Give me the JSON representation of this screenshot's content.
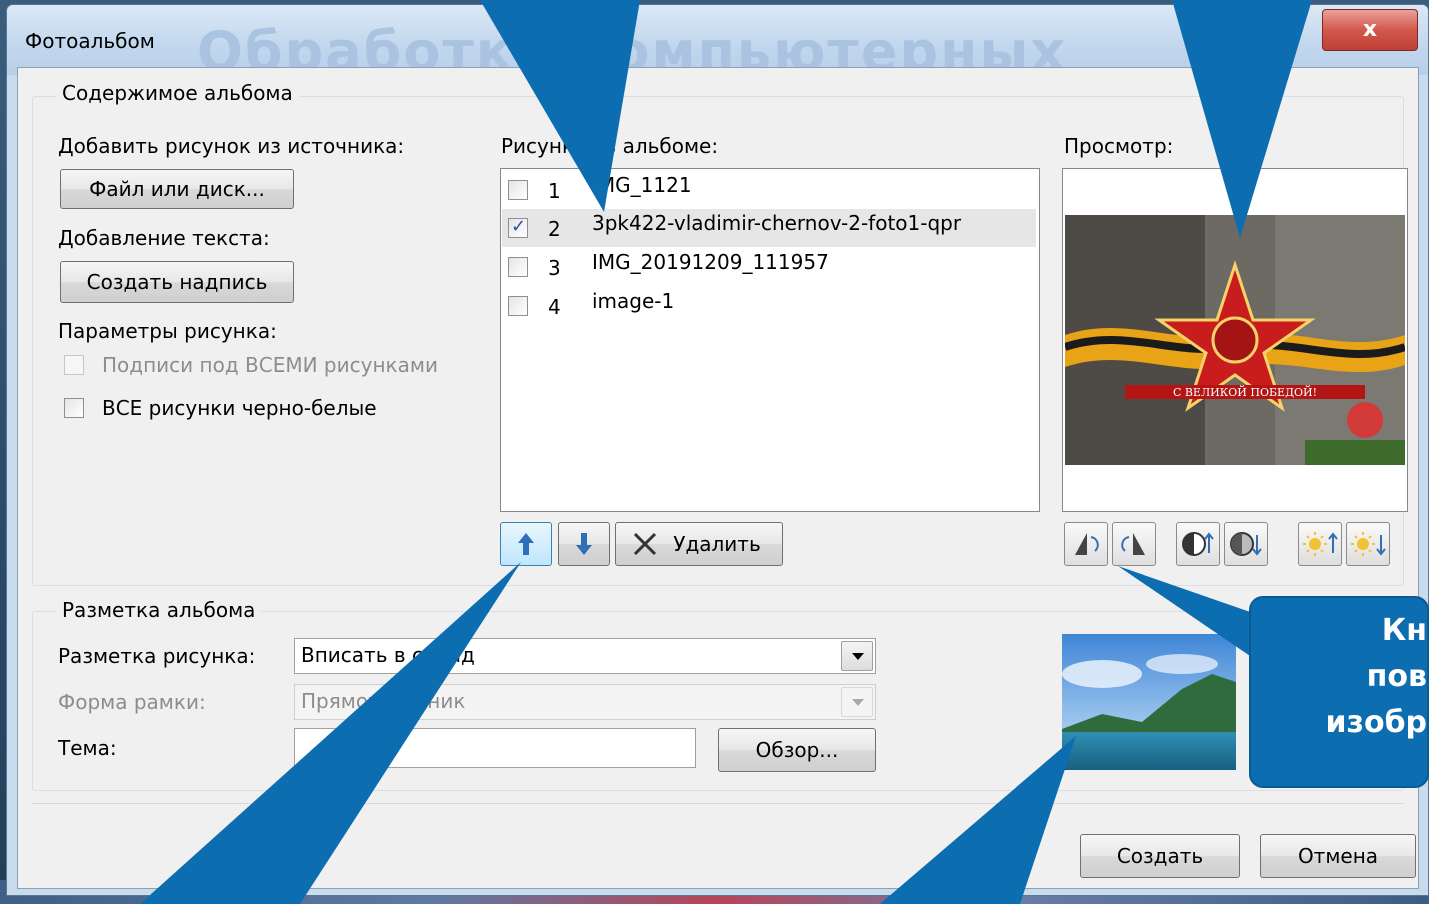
{
  "window": {
    "title": "Фотоальбом",
    "watermark": "Обработка компьютерных",
    "close_glyph": "x"
  },
  "content_group": {
    "caption": "Содержимое альбома",
    "add_from_source_label": "Добавить рисунок из источника:",
    "file_or_disk_button": "Файл или диск...",
    "add_text_label": "Добавление текста:",
    "create_caption_button": "Создать надпись",
    "picture_options_label": "Параметры рисунка:",
    "captions_below_all": {
      "label": "Подписи под ВСЕМИ рисунками",
      "checked": false,
      "enabled": false
    },
    "all_black_white": {
      "label": "ВСЕ рисунки черно-белые",
      "checked": false,
      "enabled": true
    },
    "pictures_in_album_label": "Рисунков в альбоме:",
    "pictures": [
      {
        "num": "1",
        "name": "IMG_1121",
        "checked": false,
        "selected": false
      },
      {
        "num": "2",
        "name": "3pk422-vladimir-chernov-2-foto1-qpr",
        "checked": true,
        "selected": true
      },
      {
        "num": "3",
        "name": "IMG_20191209_111957",
        "checked": false,
        "selected": false
      },
      {
        "num": "4",
        "name": "image-1",
        "checked": false,
        "selected": false
      }
    ],
    "move_up_icon": "arrow-up-icon",
    "move_down_icon": "arrow-down-icon",
    "remove_button": "Удалить",
    "preview_label": "Просмотр:",
    "preview_banner_text": "С ВЕЛИКОЙ ПОБЕДОЙ!",
    "image_tools": [
      "rotate-left-icon",
      "rotate-right-icon",
      "contrast-up-icon",
      "contrast-down-icon",
      "brightness-up-icon",
      "brightness-down-icon"
    ]
  },
  "layout_group": {
    "caption": "Разметка альбома",
    "picture_layout_label": "Разметка рисунка:",
    "picture_layout_value": "Вписать в слайд",
    "frame_shape_label": "Форма рамки:",
    "frame_shape_value": "Прямоугольник",
    "theme_label": "Тема:",
    "theme_value": "",
    "browse_button": "Обзор..."
  },
  "footer": {
    "create_button": "Создать",
    "cancel_button": "Отмена"
  },
  "callout": {
    "text": "Кн\nпов\nизобр"
  },
  "colors": {
    "callout": "#0d6db1",
    "accent": "#3b8ed6",
    "selection": "#e6e6e6"
  }
}
